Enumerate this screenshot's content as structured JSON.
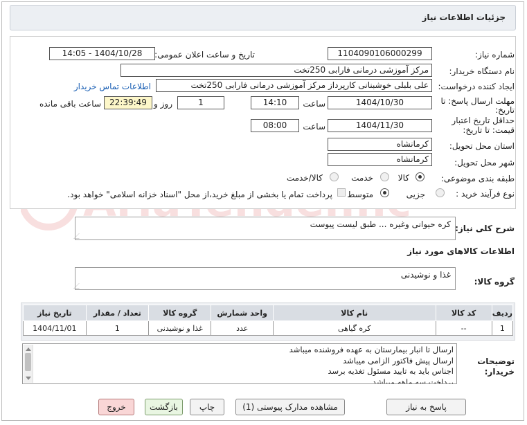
{
  "header": {
    "title": "جزئیات اطلاعات نیاز"
  },
  "form": {
    "need_number_label": "شماره نیاز:",
    "need_number": "1104090106000299",
    "announce_label": "تاریخ و ساعت اعلان عمومی:",
    "announce_value": "1404/10/28 - 14:05",
    "buyer_org_label": "نام دستگاه خریدار:",
    "buyer_org": "مرکز آموزشی  درمانی فارابی 250تخت",
    "creator_label": "ایجاد کننده درخواست:",
    "creator": "علی بلبلی خوشبنانی کارپرداز مرکز آموزشی  درمانی فارابی 250تخت",
    "contact_link": "اطلاعات تماس خریدار",
    "deadline_label_1": "مهلت ارسال پاسخ: تا",
    "deadline_label_2": "تاریخ:",
    "deadline_date": "1404/10/30",
    "time_label": "ساعت",
    "deadline_time": "14:10",
    "days": "1",
    "days_label": "روز و",
    "remaining": "22:39:49",
    "remaining_label": "ساعت باقی مانده",
    "validity_label_1": "حداقل تاریخ اعتبار",
    "validity_label_2": "قیمت: تا تاریخ:",
    "validity_date": "1404/11/30",
    "validity_time": "08:00",
    "province_label": "استان محل تحویل:",
    "province": "کرمانشاه",
    "city_label": "شهر محل تحویل:",
    "city": "کرمانشاه",
    "category_label": "طبقه بندی موضوعی:",
    "cat_goods": "کالا",
    "cat_service": "خدمت",
    "cat_goods_service": "کالا/خدمت",
    "process_label": "نوع فرآیند خرید :",
    "proc_partial": "جزیی",
    "proc_medium": "متوسط",
    "payment_note": "پرداخت تمام یا بخشی از مبلغ خرید،از محل \"اسناد خزانه اسلامی\" خواهد بود."
  },
  "summary": {
    "label": "شرح کلی نیاز:",
    "value": "کره حیوانی وغیره ... طبق لیست پیوست"
  },
  "goods_info": {
    "heading": "اطلاعات کالاهای مورد نیاز",
    "group_label": "گروه کالا:",
    "group_value": "غذا و نوشیدنی"
  },
  "table": {
    "headers": [
      "ردیف",
      "کد کالا",
      "نام کالا",
      "واحد شمارش",
      "گروه کالا",
      "تعداد / مقدار",
      "تاریخ نیاز"
    ],
    "rows": [
      [
        "1",
        "--",
        "کره گیاهی",
        "عدد",
        "غذا و نوشیدنی",
        "1",
        "1404/11/01"
      ]
    ]
  },
  "buyer_notes": {
    "label_1": "توضیحات",
    "label_2": "خریدار:",
    "lines": [
      "ارسال تا انبار بیمارستان به عهده فروشنده میباشد",
      "ارسال پیش فاکتور الزامی میباشد",
      "اجناس باید به تایید مسئول تغذیه برسد",
      "پرداخت سه ماهه میباشد"
    ]
  },
  "buttons": {
    "reply": "پاسخ به نیاز",
    "attachments": "مشاهده مدارک پیوستی (1)",
    "print": "چاپ",
    "back": "بازگشت",
    "exit": "خروج"
  },
  "watermark_text": "AriaTender.neT"
}
